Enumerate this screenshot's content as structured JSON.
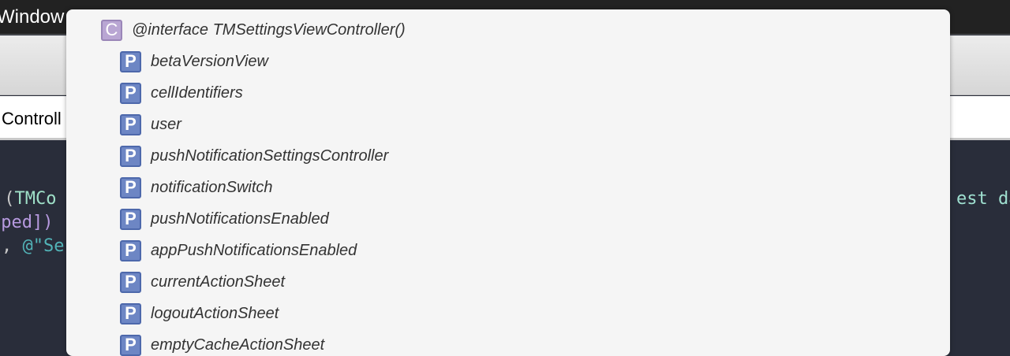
{
  "window": {
    "title": "Window"
  },
  "tab": {
    "label": "Controll"
  },
  "code": {
    "line1a": ":(",
    "line1b": "TMCo",
    "line1c": "est da",
    "line2": "uped])",
    "line3a": ", ",
    "line3b": "@\"Se"
  },
  "popup": {
    "header": {
      "badge": "C",
      "label": "@interface TMSettingsViewController()",
      "color": "#b9a6d3"
    },
    "badge": "P",
    "badge_color": "#6d86c4",
    "items": [
      "betaVersionView",
      "cellIdentifiers",
      "user",
      "pushNotificationSettingsController",
      "notificationSwitch",
      "pushNotificationsEnabled",
      "appPushNotificationsEnabled",
      "currentActionSheet",
      "logoutActionSheet",
      "emptyCacheActionSheet"
    ]
  }
}
